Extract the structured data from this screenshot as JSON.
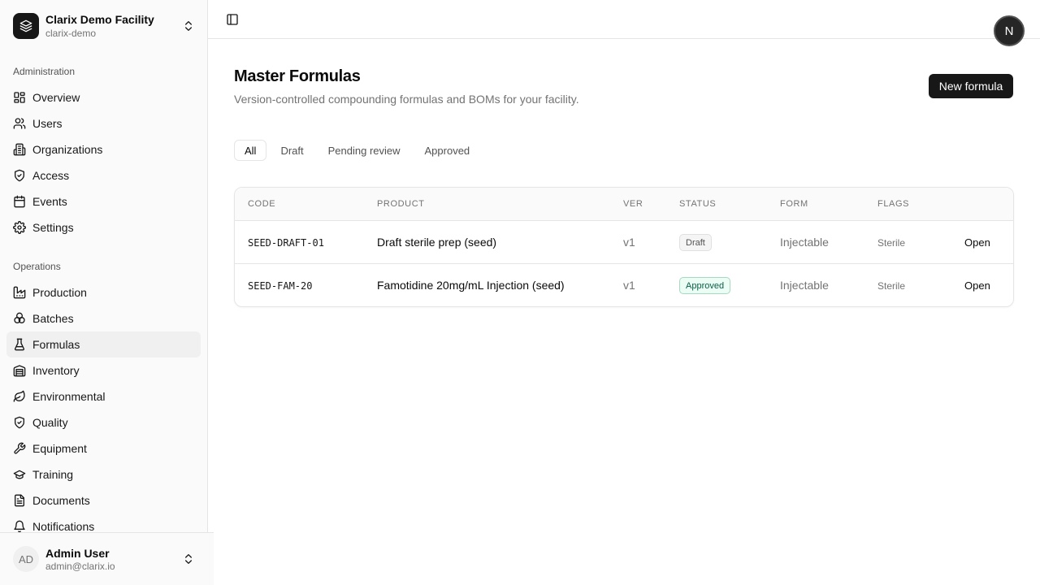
{
  "org": {
    "name": "Clarix Demo Facility",
    "slug": "clarix-demo",
    "logo_icon": "layers-icon"
  },
  "sidebar": {
    "administration_label": "Administration",
    "administration": [
      {
        "label": "Overview",
        "icon": "dashboard-icon"
      },
      {
        "label": "Users",
        "icon": "users-icon"
      },
      {
        "label": "Organizations",
        "icon": "building-icon"
      },
      {
        "label": "Access",
        "icon": "shield-check-icon"
      },
      {
        "label": "Events",
        "icon": "activity-icon"
      },
      {
        "label": "Settings",
        "icon": "gear-icon"
      }
    ],
    "operations_label": "Operations",
    "operations": [
      {
        "label": "Production",
        "icon": "factory-icon"
      },
      {
        "label": "Batches",
        "icon": "boxes-icon"
      },
      {
        "label": "Formulas",
        "icon": "flask-icon",
        "active": true
      },
      {
        "label": "Inventory",
        "icon": "warehouse-icon"
      },
      {
        "label": "Environmental",
        "icon": "leaf-icon"
      },
      {
        "label": "Quality",
        "icon": "shield-check-icon"
      },
      {
        "label": "Equipment",
        "icon": "wrench-icon"
      },
      {
        "label": "Training",
        "icon": "graduation-cap-icon"
      },
      {
        "label": "Documents",
        "icon": "file-icon"
      },
      {
        "label": "Notifications",
        "icon": "bell-icon"
      }
    ]
  },
  "user": {
    "initials": "AD",
    "name": "Admin User",
    "email": "admin@clarix.io"
  },
  "header": {
    "profile_initial": "N"
  },
  "page": {
    "title": "Master Formulas",
    "subtitle": "Version-controlled compounding formulas and BOMs for your facility.",
    "new_button": "New formula"
  },
  "tabs": [
    "All",
    "Draft",
    "Pending review",
    "Approved"
  ],
  "active_tab": "All",
  "table": {
    "columns": [
      "CODE",
      "PRODUCT",
      "VER",
      "STATUS",
      "FORM",
      "FLAGS"
    ],
    "rows": [
      {
        "code": "SEED-DRAFT-01",
        "product": "Draft sterile prep (seed)",
        "ver": "v1",
        "status": "Draft",
        "form": "Injectable",
        "flags": "Sterile",
        "action": "Open"
      },
      {
        "code": "SEED-FAM-20",
        "product": "Famotidine 20mg/mL Injection (seed)",
        "ver": "v1",
        "status": "Approved",
        "form": "Injectable",
        "flags": "Sterile",
        "action": "Open"
      }
    ]
  },
  "colors": {
    "accent": "#171717",
    "approved_bg": "#ecfdf5",
    "approved_text": "#065f46",
    "draft_bg": "#f5f5f5"
  }
}
